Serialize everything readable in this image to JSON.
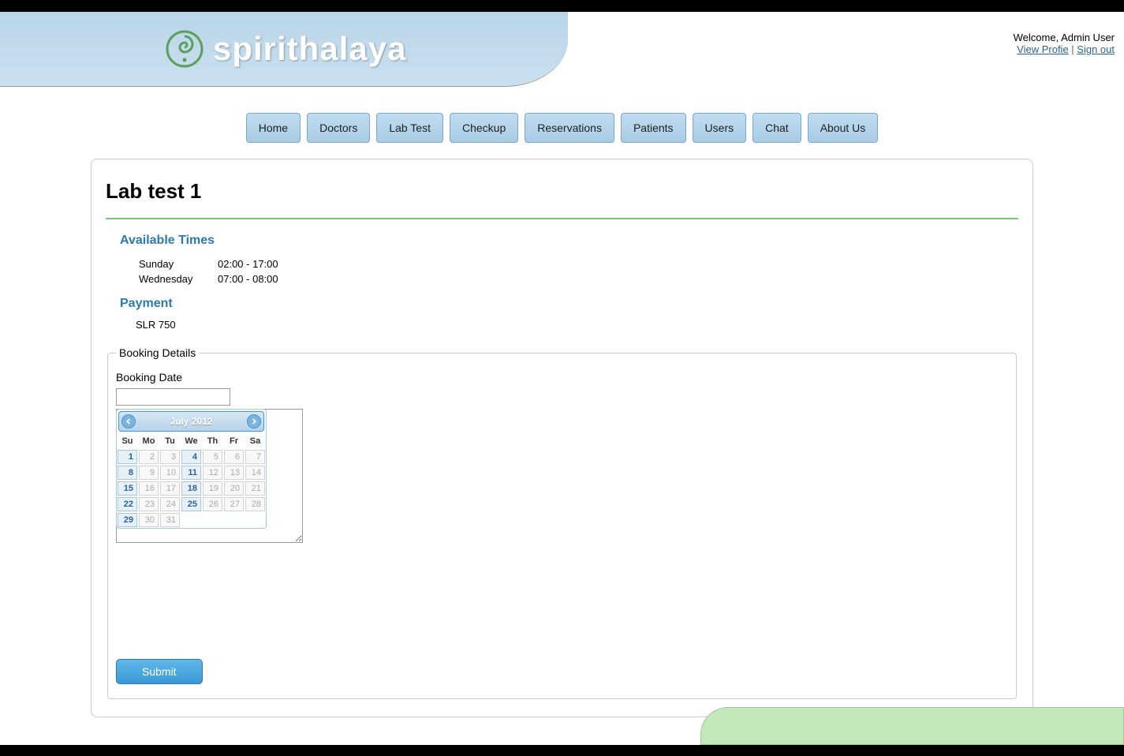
{
  "header": {
    "logo_text": "spirithalaya"
  },
  "user_info": {
    "welcome": "Welcome, Admin User",
    "view_profile": "View Profie",
    "sign_out": "Sign out"
  },
  "nav": [
    "Home",
    "Doctors",
    "Lab Test",
    "Checkup",
    "Reservations",
    "Patients",
    "Users",
    "Chat",
    "About Us"
  ],
  "page": {
    "title": "Lab test 1"
  },
  "available_times": {
    "heading": "Available Times",
    "rows": [
      {
        "day": "Sunday",
        "time": "02:00 - 17:00"
      },
      {
        "day": "Wednesday",
        "time": "07:00 - 08:00"
      }
    ]
  },
  "payment": {
    "heading": "Payment",
    "value": "SLR 750"
  },
  "booking": {
    "legend": "Booking Details",
    "date_label": "Booking Date",
    "submit": "Submit"
  },
  "datepicker": {
    "title": "July 2012",
    "day_headers": [
      "Su",
      "Mo",
      "Tu",
      "We",
      "Th",
      "Fr",
      "Sa"
    ],
    "weeks": [
      [
        {
          "n": "1",
          "a": true
        },
        {
          "n": "2",
          "a": false
        },
        {
          "n": "3",
          "a": false
        },
        {
          "n": "4",
          "a": true
        },
        {
          "n": "5",
          "a": false
        },
        {
          "n": "6",
          "a": false
        },
        {
          "n": "7",
          "a": false
        }
      ],
      [
        {
          "n": "8",
          "a": true
        },
        {
          "n": "9",
          "a": false
        },
        {
          "n": "10",
          "a": false
        },
        {
          "n": "11",
          "a": true
        },
        {
          "n": "12",
          "a": false
        },
        {
          "n": "13",
          "a": false
        },
        {
          "n": "14",
          "a": false
        }
      ],
      [
        {
          "n": "15",
          "a": true
        },
        {
          "n": "16",
          "a": false
        },
        {
          "n": "17",
          "a": false
        },
        {
          "n": "18",
          "a": true
        },
        {
          "n": "19",
          "a": false
        },
        {
          "n": "20",
          "a": false
        },
        {
          "n": "21",
          "a": false
        }
      ],
      [
        {
          "n": "22",
          "a": true
        },
        {
          "n": "23",
          "a": false
        },
        {
          "n": "24",
          "a": false
        },
        {
          "n": "25",
          "a": true
        },
        {
          "n": "26",
          "a": false
        },
        {
          "n": "27",
          "a": false
        },
        {
          "n": "28",
          "a": false
        }
      ],
      [
        {
          "n": "29",
          "a": true
        },
        {
          "n": "30",
          "a": false
        },
        {
          "n": "31",
          "a": false
        },
        {
          "n": "",
          "a": false
        },
        {
          "n": "",
          "a": false
        },
        {
          "n": "",
          "a": false
        },
        {
          "n": "",
          "a": false
        }
      ]
    ]
  }
}
